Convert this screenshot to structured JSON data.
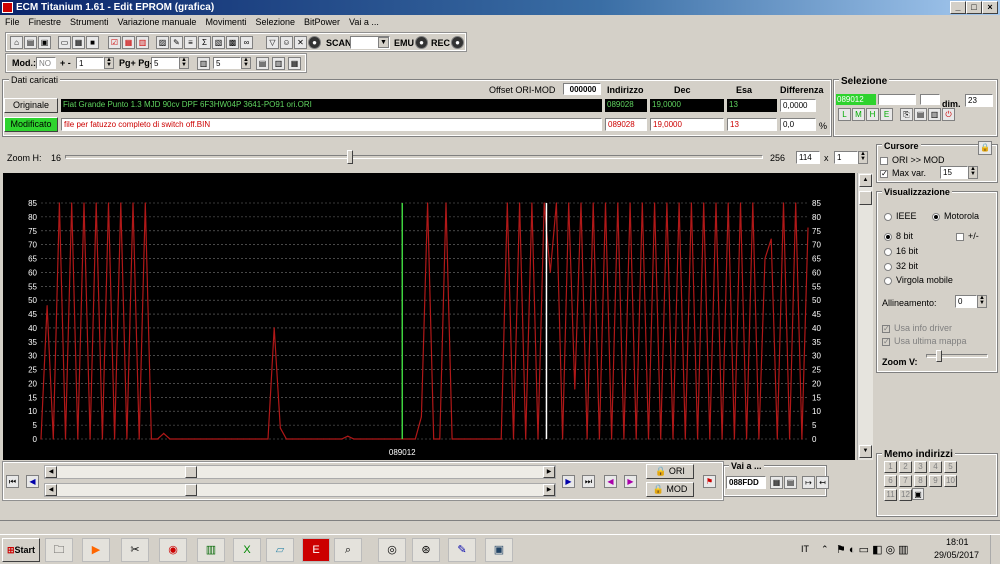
{
  "window": {
    "title": "ECM Titanium 1.61 - Edit EPROM (grafica)"
  },
  "menu": [
    "File",
    "Finestre",
    "Strumenti",
    "Variazione manuale",
    "Movimenti",
    "Selezione",
    "BitPower",
    "Vai a ..."
  ],
  "toolbar": {
    "scan_label": "SCAN",
    "emu_label": "EMU",
    "rec_label": "REC"
  },
  "toolbar2": {
    "mod_label": "Mod.:",
    "mod_value": "NO",
    "plusminus_label": "+ -",
    "plusminus_value": "1",
    "pg_label": "Pg+ Pg-",
    "pg_value": "5",
    "f2_value": "5"
  },
  "dati": {
    "title": "Dati caricati",
    "offset_label": "Offset ORI-MOD",
    "offset_value": "000000",
    "headers": {
      "indirizzo": "Indirizzo",
      "dec": "Dec",
      "esa": "Esa",
      "differenza": "Differenza"
    },
    "originale": {
      "label": "Originale",
      "file": "Fiat Grande Punto 1.3 MJD 90cv DPF 6F3HW04P 3641-PO91 ori.ORI",
      "indirizzo": "089028",
      "dec": "19,0000",
      "esa": "13",
      "differenza": "0,0000"
    },
    "modificato": {
      "label": "Modificato",
      "file": "file per fatuzzo completo di switch off.BIN",
      "indirizzo": "089028",
      "dec": "19,0000",
      "esa": "13",
      "differenza": "0,0",
      "percent": "%"
    }
  },
  "selezione": {
    "title": "Selezione",
    "addr": "089012",
    "dim_label": "dim.",
    "dim_value": "23"
  },
  "zoom": {
    "label": "Zoom H:",
    "min": "16",
    "max": "256",
    "value": "114",
    "x": "x",
    "mult": "1"
  },
  "cursore": {
    "title": "Cursore",
    "ori_mod": "ORI >> MOD",
    "max_var": "Max var.",
    "max_var_value": "15"
  },
  "visualizzazione": {
    "title": "Visualizzazione",
    "ieee": "IEEE",
    "motorola": "Motorola",
    "b8": "8 bit",
    "sign": "+/-",
    "b16": "16 bit",
    "b32": "32 bit",
    "virgola": "Virgola mobile",
    "allineamento": "Allineamento:",
    "allineamento_value": "0",
    "info_driver": "Usa info driver",
    "ultima_mappa": "Usa ultima mappa",
    "zoom_v": "Zoom V:"
  },
  "memo": {
    "title": "Memo indirizzi",
    "buttons": [
      "1",
      "2",
      "3",
      "4",
      "5",
      "6",
      "7",
      "8",
      "9",
      "10",
      "11",
      "12"
    ]
  },
  "bottom": {
    "ori_label": "ORI",
    "mod_label": "MOD",
    "vai_label": "Vai a ...",
    "vai_value": "088FDD"
  },
  "chart_data": {
    "type": "line",
    "yticks": [
      "0",
      "5",
      "10",
      "15",
      "20",
      "25",
      "30",
      "35",
      "40",
      "45",
      "50",
      "55",
      "60",
      "65",
      "70",
      "75",
      "80",
      "85"
    ],
    "ylim": [
      0,
      85
    ],
    "grid": true,
    "cursor_label": "089012",
    "series": [
      {
        "color": "#b01818",
        "values": [
          0,
          48,
          0,
          85,
          0,
          85,
          0,
          85,
          0,
          85,
          0,
          85,
          0,
          85,
          0,
          85,
          0,
          85,
          0,
          0,
          2,
          0,
          0,
          0,
          0,
          0,
          0,
          0,
          0,
          0,
          0,
          0,
          0,
          0,
          0,
          0,
          0,
          0,
          40,
          4,
          0,
          0,
          0,
          0,
          0,
          0,
          0,
          0,
          0,
          0,
          1,
          0,
          0,
          0,
          0,
          0,
          0,
          0,
          0,
          0,
          0,
          0,
          8,
          85,
          0,
          0,
          85,
          0,
          0,
          0,
          0,
          0,
          0,
          0,
          0,
          0,
          85,
          0,
          85,
          0,
          85,
          0,
          85,
          60,
          85,
          0,
          85,
          18,
          85,
          0,
          85,
          0,
          85,
          0,
          85,
          0,
          85,
          0,
          85,
          0,
          85,
          0,
          85,
          0,
          85,
          0,
          85,
          0,
          85,
          0,
          85,
          0,
          85,
          0,
          85,
          0,
          85,
          0,
          65,
          72,
          0,
          85,
          0,
          85,
          0,
          76
        ]
      }
    ],
    "colors": {
      "background": "#000000",
      "grid": "#c0c0c0",
      "line": "#b01818",
      "cursor_green": "#3fd23f",
      "cursor_white": "#ffffff"
    }
  },
  "taskbar": {
    "start": "Start",
    "lang": "IT",
    "time": "18:01",
    "date": "29/05/2017"
  }
}
